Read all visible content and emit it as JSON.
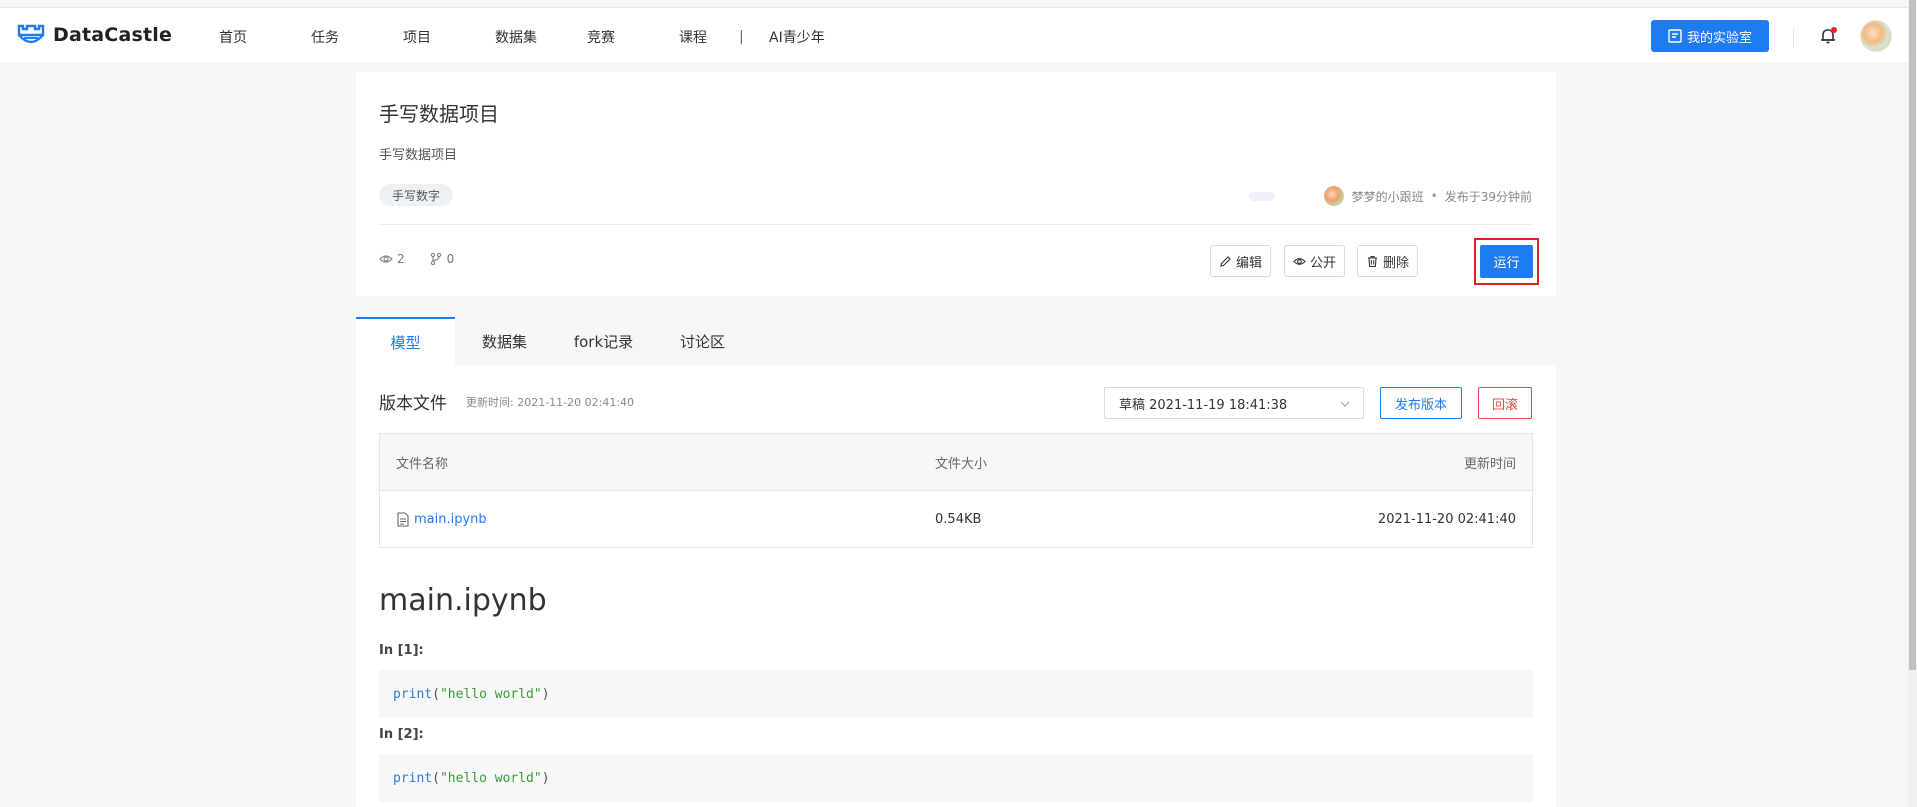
{
  "brand": {
    "name": "DataCastle",
    "logo_icon": "castle-logo-icon"
  },
  "nav": {
    "items": [
      "首页",
      "任务",
      "项目",
      "数据集",
      "竞赛",
      "课程"
    ],
    "separator": "|",
    "extra": "AI青少年",
    "lab_button": "我的实验室"
  },
  "project": {
    "title": "手写数据项目",
    "description": "手写数据项目",
    "tag": "手写数字",
    "author": "梦梦的小跟班",
    "published": "发布于39分钟前",
    "dot": "•",
    "views": "2",
    "forks": "0",
    "actions": {
      "edit": "编辑",
      "public": "公开",
      "delete": "删除",
      "run": "运行"
    }
  },
  "tabs": [
    {
      "label": "模型",
      "active": true
    },
    {
      "label": "数据集",
      "active": false
    },
    {
      "label": "fork记录",
      "active": false
    },
    {
      "label": "讨论区",
      "active": false
    }
  ],
  "versions": {
    "section_title": "版本文件",
    "updated_label": "更新时间: 2021-11-20 02:41:40",
    "selected_version": "草稿 2021-11-19 18:41:38",
    "publish_button": "发布版本",
    "rollback_button": "回滚"
  },
  "file_table": {
    "headers": {
      "name": "文件名称",
      "size": "文件大小",
      "time": "更新时间"
    },
    "rows": [
      {
        "name": "main.ipynb",
        "size": "0.54KB",
        "time": "2021-11-20 02:41:40"
      }
    ]
  },
  "notebook": {
    "title": "main.ipynb",
    "cells": [
      {
        "label": "In [1]:",
        "fn": "print",
        "open": "(",
        "arg": "\"hello world\"",
        "close": ")"
      },
      {
        "label": "In [2]:",
        "fn": "print",
        "open": "(",
        "arg": "\"hello world\"",
        "close": ")"
      }
    ]
  },
  "colors": {
    "primary": "#1f7bf0",
    "danger": "#e84a4a",
    "highlight": "#e02020"
  }
}
